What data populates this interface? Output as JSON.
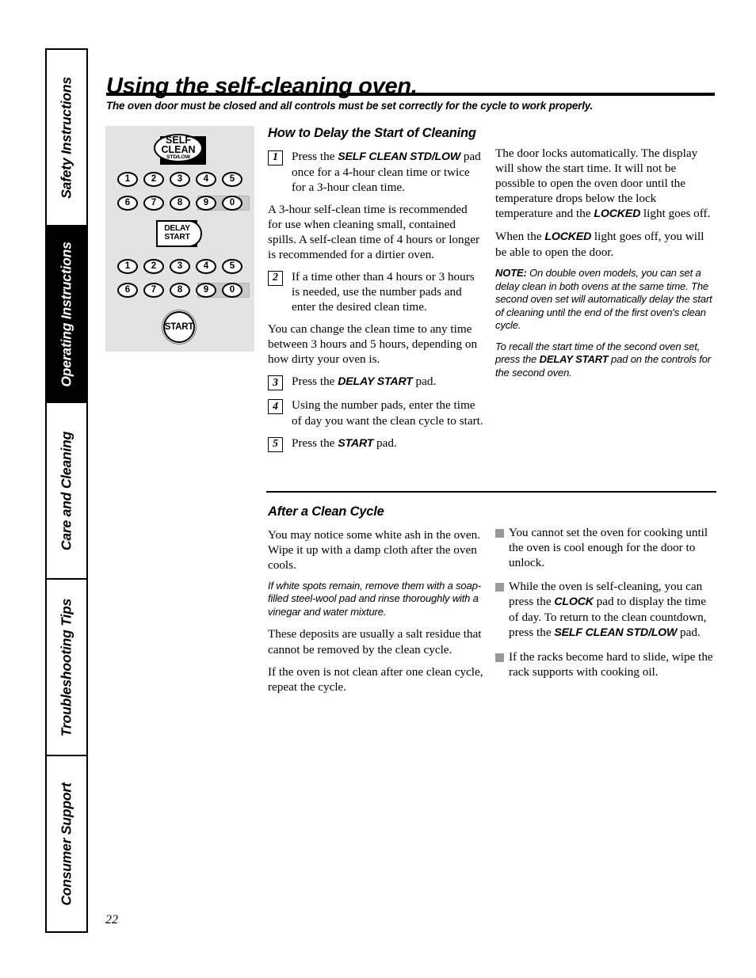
{
  "page": {
    "title": "Using the self-cleaning oven.",
    "subtitle": "The oven door must be closed and all controls must be set correctly for the cycle to work properly.",
    "number": "22"
  },
  "sidebar": {
    "tabs": [
      {
        "label": "Safety Instructions",
        "active": false
      },
      {
        "label": "Operating Instructions",
        "active": true
      },
      {
        "label": "Care and Cleaning",
        "active": false
      },
      {
        "label": "Troubleshooting Tips",
        "active": false
      },
      {
        "label": "Consumer Support",
        "active": false
      }
    ]
  },
  "control_panel": {
    "self_clean": {
      "line1": "SELF",
      "line2": "CLEAN",
      "line3": "STD/LOW"
    },
    "delay_start": {
      "line1": "DELAY",
      "line2": "START"
    },
    "start": "START",
    "numpad_row1": [
      "1",
      "2",
      "3",
      "4",
      "5"
    ],
    "numpad_row2": [
      "6",
      "7",
      "8",
      "9",
      "0"
    ],
    "numpad2_row1": [
      "1",
      "2",
      "3",
      "4",
      "5"
    ],
    "numpad2_row2": [
      "6",
      "7",
      "8",
      "9",
      "0"
    ],
    "panel_color": "#e3e3e3"
  },
  "delay_section": {
    "heading": "How to Delay the Start of Cleaning",
    "step1": {
      "num": "1",
      "text_pre": "Press the ",
      "pad": "SELF CLEAN STD/LOW",
      "text_post": " pad once for a 4-hour clean time or twice for a 3-hour clean time."
    },
    "step1_sub": "A 3-hour self-clean time is recommended for use when cleaning small, contained spills. A self-clean time of 4 hours or longer is recommended for a dirtier oven.",
    "step2": {
      "num": "2",
      "text": "If a time other than 4 hours or 3 hours is needed, use the number pads and enter the desired clean time."
    },
    "paragraph": "You can change the clean time to any time between 3 hours and 5 hours, depending on how dirty your oven is.",
    "step3": {
      "num": "3",
      "text_pre": "Press the ",
      "pad": "DELAY START",
      "text_post": " pad."
    },
    "step4": {
      "num": "4",
      "text": "Using the number pads, enter the time of day you want the clean cycle to start."
    },
    "step5": {
      "num": "5",
      "text_pre": "Press the ",
      "pad": "START",
      "text_post": " pad."
    },
    "right_p1_a": "The door locks automatically. The display will show the start time. It will not be possible to open the oven door until the temperature drops below the lock temperature and the ",
    "right_p1_pad": "LOCKED",
    "right_p1_b": " light goes off.",
    "right_p2_a": "When the ",
    "right_p2_pad": "LOCKED",
    "right_p2_b": " light goes off, you will be able to open the door.",
    "note_label": "NOTE:",
    "note_text": " On double oven models, you can set a delay clean in both ovens at the same time. The second oven set will automatically delay the start of cleaning until the end of the first oven's clean cycle.",
    "recall_a": "To recall the start time of the second oven set, press the ",
    "recall_pad": "DELAY START",
    "recall_b": " pad on the controls for the second oven."
  },
  "after_section": {
    "heading": "After a Clean Cycle",
    "p1": "You may notice some white ash in the oven. Wipe it up with a damp cloth after the oven cools.",
    "italic": "If white spots remain, remove them with a soap-filled steel-wool pad and rinse thoroughly with a vinegar and water mixture.",
    "p2": "These deposits are usually a salt residue that cannot be removed by the clean cycle.",
    "p3": "If the oven is not clean after one clean cycle, repeat the cycle.",
    "bullet1": "You cannot set the oven for cooking until the oven is cool enough for the door to unlock.",
    "bullet2_a": "While the oven is self-cleaning, you can press the ",
    "bullet2_pad1": "CLOCK",
    "bullet2_b": " pad to display the time of day. To return to the clean countdown, press the ",
    "bullet2_pad2": "SELF CLEAN STD/LOW",
    "bullet2_c": " pad.",
    "bullet3": "If the racks become hard to slide, wipe the rack supports with cooking oil."
  }
}
